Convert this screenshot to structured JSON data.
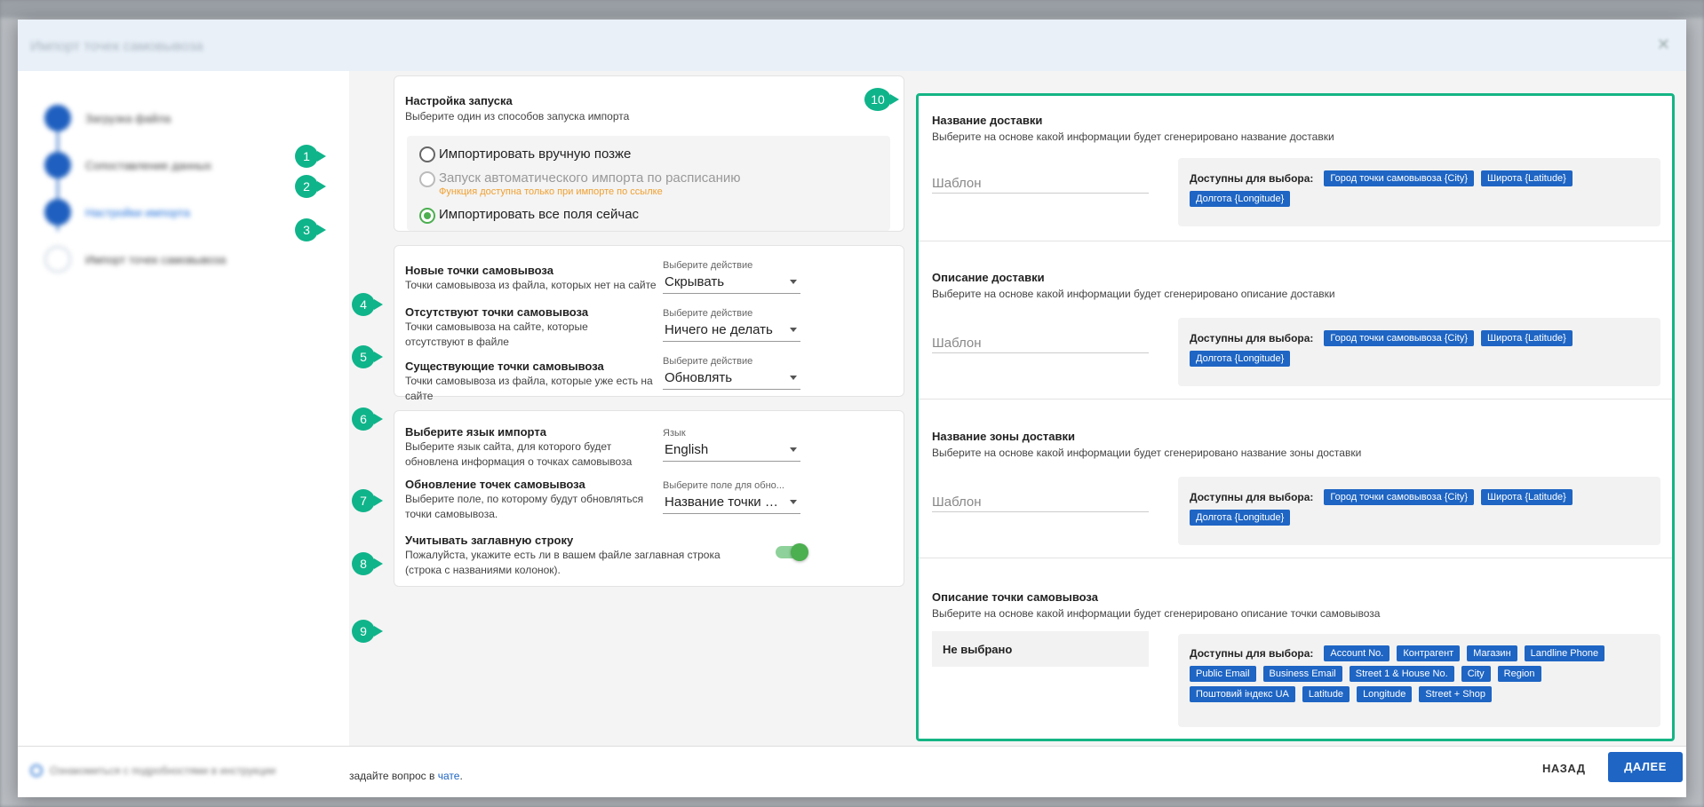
{
  "modal": {
    "title": "Импорт точек самовывоза"
  },
  "stepper": {
    "steps": [
      {
        "label": "Загрузка файла"
      },
      {
        "label": "Сопоставление данных"
      },
      {
        "label": "Настройки импорта"
      },
      {
        "label": "Импорт точек самовывоза"
      }
    ]
  },
  "launch": {
    "title": "Настройка запуска",
    "subtitle": "Выберите один из способов запуска импорта",
    "options": [
      {
        "label": "Импортировать вручную позже",
        "hint": ""
      },
      {
        "label": "Запуск автоматического импорта по расписанию",
        "hint": "Функция доступна только при импорте по ссылке"
      },
      {
        "label": "Импортировать все поля сейчас",
        "hint": ""
      }
    ],
    "selected": "Импортировать все поля сейчас"
  },
  "actions": {
    "rows": [
      {
        "title": "Новые точки самовывоза",
        "desc": "Точки самовывоза из файла, которых нет на сайте",
        "select_label": "Выберите действие",
        "select_value": "Скрывать"
      },
      {
        "title": "Отсутствуют точки самовывоза",
        "desc": "Точки самовывоза на сайте, которые отсутствуют в файле",
        "select_label": "Выберите действие",
        "select_value": "Ничего не делать"
      },
      {
        "title": "Существующие точки самовывоза",
        "desc": "Точки самовывоза из файла, которые уже есть на сайте",
        "select_label": "Выберите действие",
        "select_value": "Обновлять"
      }
    ]
  },
  "settings": {
    "language": {
      "title": "Выберите язык импорта",
      "desc": "Выберите язык сайта, для которого будет обновлена информация о точках самовывоза",
      "select_label": "Язык",
      "select_value": "English"
    },
    "update": {
      "title": "Обновление точек самовывоза",
      "desc": "Выберите поле, по которому будут обновляться точки самовывоза.",
      "select_label": "Выберите поле для обно...",
      "select_value": "Название точки сам..."
    },
    "header_row": {
      "title": "Учитывать заглавную строку",
      "desc": "Пожалуйста, укажите есть ли в вашем файле заглавная строка (строка с названиями колонок).",
      "toggle_on": true
    }
  },
  "badges": [
    "1",
    "2",
    "3",
    "4",
    "5",
    "6",
    "7",
    "8",
    "9",
    "10"
  ],
  "right_panel": {
    "available_label": "Доступны для выбора:",
    "template_placeholder": "Шаблон",
    "sections": [
      {
        "title": "Название доставки",
        "desc": "Выберите на основе какой информации будет сгенерировано название доставки",
        "field": "Шаблон",
        "tags": [
          "Город точки самовывоза {City}",
          "Широта {Latitude}",
          "Долгота {Longitude}"
        ]
      },
      {
        "title": "Описание доставки",
        "desc": "Выберите на основе какой информации будет сгенерировано описание доставки",
        "field": "Шаблон",
        "tags": [
          "Город точки самовывоза {City}",
          "Широта {Latitude}",
          "Долгота {Longitude}"
        ]
      },
      {
        "title": "Название зоны доставки",
        "desc": "Выберите на основе какой информации будет сгенерировано название зоны доставки",
        "field": "Шаблон",
        "tags": [
          "Город точки самовывоза {City}",
          "Широта {Latitude}",
          "Долгота {Longitude}"
        ]
      },
      {
        "title": "Описание точки самовывоза",
        "desc": "Выберите на основе какой информации будет сгенерировано описание точки самовывоза",
        "field": "Не выбрано",
        "tags": [
          "Account No.",
          "Контрагент",
          "Магазин",
          "Landline Phone",
          "Public Email",
          "Business Email",
          "Street 1 & House No.",
          "City",
          "Region",
          "Поштовий індекс UA",
          "Latitude",
          "Longitude",
          "Street + Shop"
        ]
      }
    ]
  },
  "footer": {
    "blurred_text": "Ознакомиться с подробностями в инструкции",
    "help_prefix": "задайте вопрос в ",
    "help_link": "чате",
    "help_suffix": ".",
    "back_label": "НАЗАД",
    "next_label": "ДАЛЕЕ"
  },
  "colors": {
    "accent_green": "#14b585",
    "primary_blue": "#1e65c4",
    "warning_orange": "#f0a030"
  }
}
